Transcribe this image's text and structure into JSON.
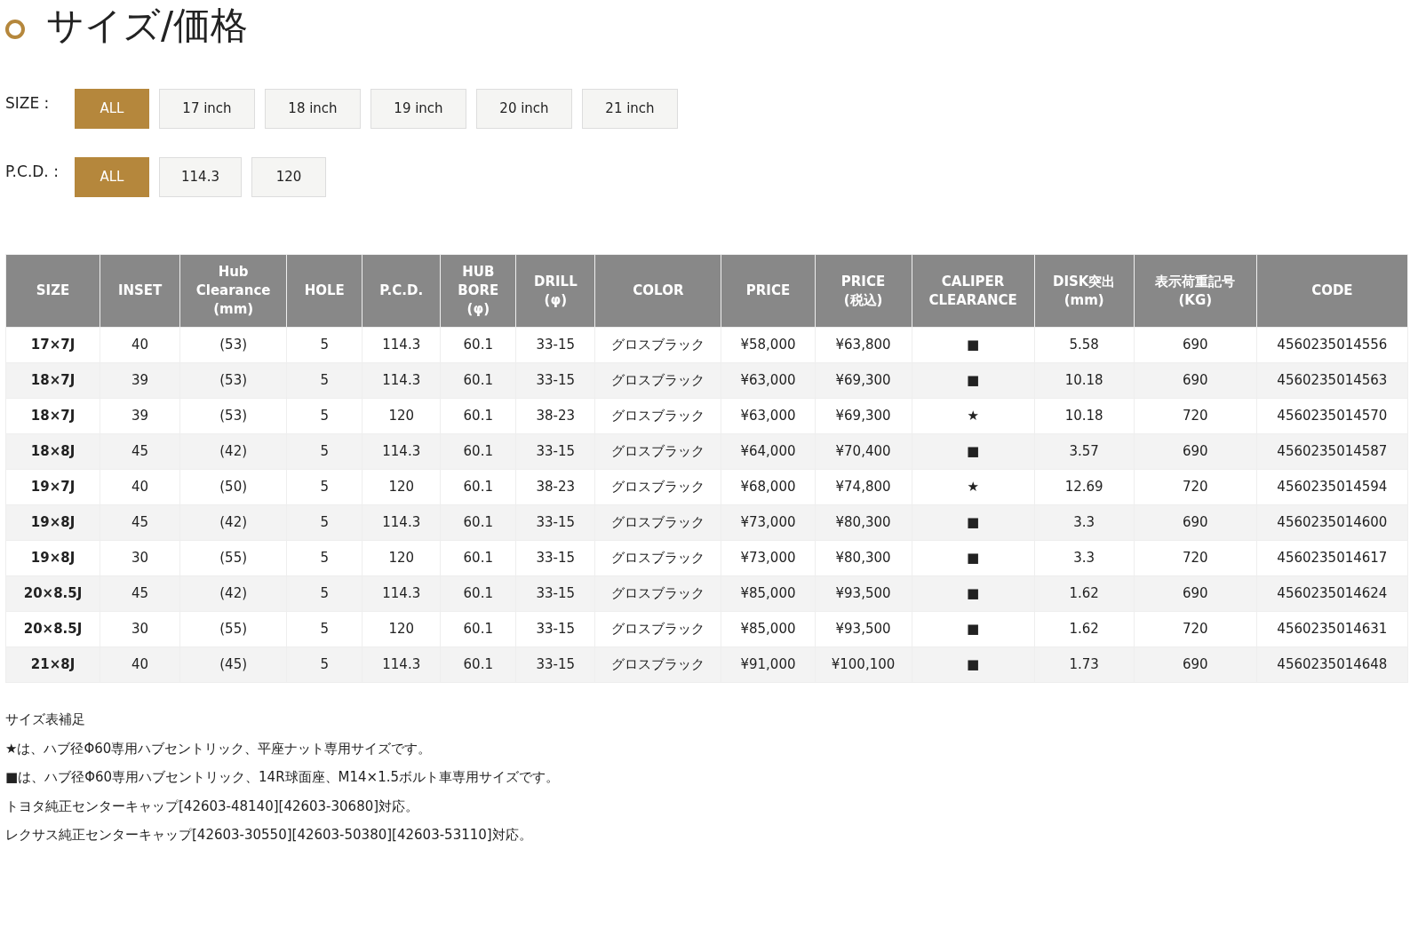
{
  "title": "サイズ/価格",
  "filters": [
    {
      "label": "SIZE :",
      "options": [
        {
          "label": "ALL",
          "selected": true
        },
        {
          "label": "17 inch",
          "selected": false
        },
        {
          "label": "18 inch",
          "selected": false
        },
        {
          "label": "19 inch",
          "selected": false
        },
        {
          "label": "20 inch",
          "selected": false
        },
        {
          "label": "21 inch",
          "selected": false
        }
      ]
    },
    {
      "label": "P.C.D. :",
      "options": [
        {
          "label": "ALL",
          "selected": true
        },
        {
          "label": "114.3",
          "selected": false
        },
        {
          "label": "120",
          "selected": false
        }
      ]
    }
  ],
  "table": {
    "columns": [
      "SIZE",
      "INSET",
      "Hub\nClearance\n(mm)",
      "HOLE",
      "P.C.D.",
      "HUB\nBORE\n(φ)",
      "DRILL\n(φ)",
      "COLOR",
      "PRICE",
      "PRICE\n(税込)",
      "CALIPER\nCLEARANCE",
      "DISK突出\n(mm)",
      "表示荷重記号\n(KG)",
      "CODE"
    ],
    "rows": [
      [
        "17×7J",
        "40",
        "(53)",
        "5",
        "114.3",
        "60.1",
        "33-15",
        "グロスブラック",
        "¥58,000",
        "¥63,800",
        "■",
        "5.58",
        "690",
        "4560235014556"
      ],
      [
        "18×7J",
        "39",
        "(53)",
        "5",
        "114.3",
        "60.1",
        "33-15",
        "グロスブラック",
        "¥63,000",
        "¥69,300",
        "■",
        "10.18",
        "690",
        "4560235014563"
      ],
      [
        "18×7J",
        "39",
        "(53)",
        "5",
        "120",
        "60.1",
        "38-23",
        "グロスブラック",
        "¥63,000",
        "¥69,300",
        "★",
        "10.18",
        "720",
        "4560235014570"
      ],
      [
        "18×8J",
        "45",
        "(42)",
        "5",
        "114.3",
        "60.1",
        "33-15",
        "グロスブラック",
        "¥64,000",
        "¥70,400",
        "■",
        "3.57",
        "690",
        "4560235014587"
      ],
      [
        "19×7J",
        "40",
        "(50)",
        "5",
        "120",
        "60.1",
        "38-23",
        "グロスブラック",
        "¥68,000",
        "¥74,800",
        "★",
        "12.69",
        "720",
        "4560235014594"
      ],
      [
        "19×8J",
        "45",
        "(42)",
        "5",
        "114.3",
        "60.1",
        "33-15",
        "グロスブラック",
        "¥73,000",
        "¥80,300",
        "■",
        "3.3",
        "690",
        "4560235014600"
      ],
      [
        "19×8J",
        "30",
        "(55)",
        "5",
        "120",
        "60.1",
        "33-15",
        "グロスブラック",
        "¥73,000",
        "¥80,300",
        "■",
        "3.3",
        "720",
        "4560235014617"
      ],
      [
        "20×8.5J",
        "45",
        "(42)",
        "5",
        "114.3",
        "60.1",
        "33-15",
        "グロスブラック",
        "¥85,000",
        "¥93,500",
        "■",
        "1.62",
        "690",
        "4560235014624"
      ],
      [
        "20×8.5J",
        "30",
        "(55)",
        "5",
        "120",
        "60.1",
        "33-15",
        "グロスブラック",
        "¥85,000",
        "¥93,500",
        "■",
        "1.62",
        "720",
        "4560235014631"
      ],
      [
        "21×8J",
        "40",
        "(45)",
        "5",
        "114.3",
        "60.1",
        "33-15",
        "グロスブラック",
        "¥91,000",
        "¥100,100",
        "■",
        "1.73",
        "690",
        "4560235014648"
      ]
    ]
  },
  "notes": [
    "サイズ表補足",
    "★は、ハブ径Φ60専用ハブセントリック、平座ナット専用サイズです。",
    "■は、ハブ径Φ60専用ハブセントリック、14R球面座、M14×1.5ボルト車専用サイズです。",
    "トヨタ純正センターキャップ[42603-48140][42603-30680]対応。",
    "レクサス純正センターキャップ[42603-30550][42603-50380][42603-53110]対応。"
  ]
}
